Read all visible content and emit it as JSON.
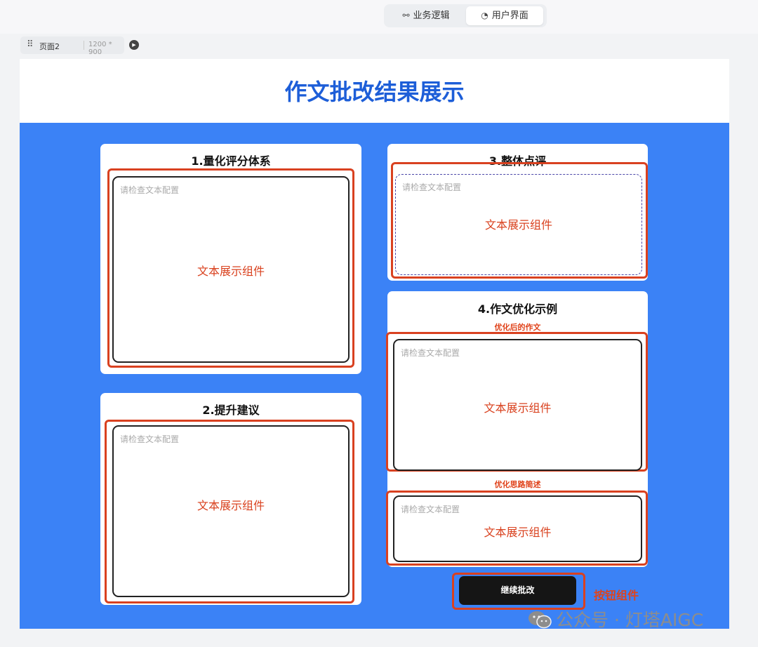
{
  "toolbar": {
    "tabs": [
      {
        "label": "业务逻辑",
        "icon": "flow-icon"
      },
      {
        "label": "用户界面",
        "icon": "palette-icon"
      }
    ]
  },
  "page_tag": {
    "name": "页面2",
    "size": "1200 * 900"
  },
  "canvas": {
    "title": "作文批改结果展示",
    "background_color": "#3b82f6",
    "title_color": "#1d5ed8",
    "annotation_color": "#d94120",
    "cards": {
      "scoring": {
        "title": "1.量化评分体系"
      },
      "suggestion": {
        "title": "2.提升建议"
      },
      "review": {
        "title": "3.整体点评"
      },
      "example": {
        "title": "4.作文优化示例",
        "sub1": "优化后的作文",
        "sub2": "优化思路简述"
      }
    },
    "textbox": {
      "placeholder": "请检查文本配置",
      "component_label": "文本展示组件"
    },
    "continue_button": {
      "label": "继续批改"
    },
    "button_annotation": "按钮组件"
  },
  "watermark": "公众号 · 灯塔AIGC"
}
